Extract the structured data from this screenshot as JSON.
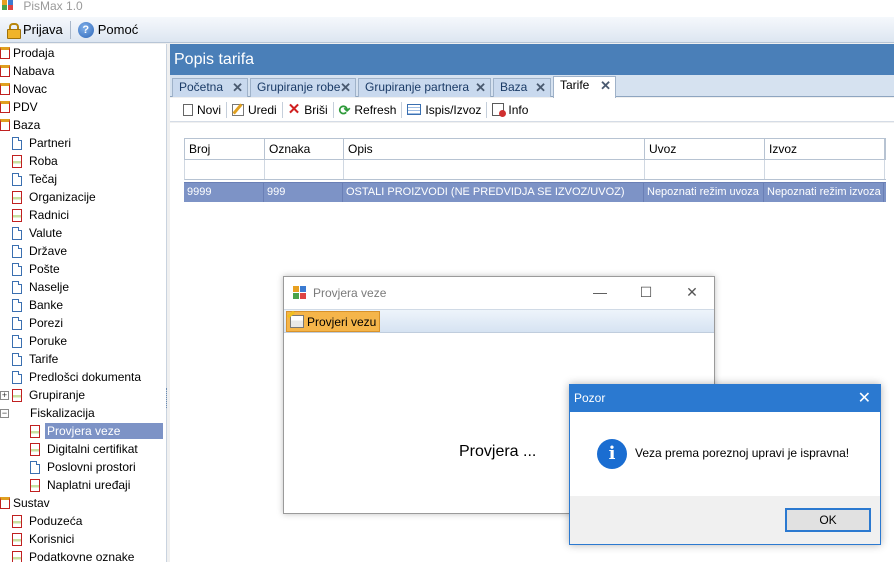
{
  "app": {
    "title": "PisMax 1.0"
  },
  "menu": {
    "login": "Prijava",
    "help": "Pomoć"
  },
  "sidebar": {
    "items": [
      {
        "label": "Prodaja",
        "type": "folder"
      },
      {
        "label": "Nabava",
        "type": "folder"
      },
      {
        "label": "Novac",
        "type": "folder"
      },
      {
        "label": "PDV",
        "type": "folder"
      },
      {
        "label": "Baza",
        "type": "folder"
      },
      {
        "label": "Partneri",
        "type": "doc"
      },
      {
        "label": "Roba",
        "type": "doc-red"
      },
      {
        "label": "Tečaj",
        "type": "doc"
      },
      {
        "label": "Organizacije",
        "type": "doc-red"
      },
      {
        "label": "Radnici",
        "type": "doc-red"
      },
      {
        "label": "Valute",
        "type": "doc"
      },
      {
        "label": "Države",
        "type": "doc"
      },
      {
        "label": "Pošte",
        "type": "doc"
      },
      {
        "label": "Naselje",
        "type": "doc"
      },
      {
        "label": "Banke",
        "type": "doc"
      },
      {
        "label": "Porezi",
        "type": "doc"
      },
      {
        "label": "Poruke",
        "type": "doc"
      },
      {
        "label": "Tarife",
        "type": "doc"
      },
      {
        "label": "Predlošci dokumenta",
        "type": "doc"
      },
      {
        "label": "Grupiranje",
        "type": "doc-red",
        "expander": "+"
      },
      {
        "label": "Fiskalizacija",
        "type": "none",
        "expander": "-"
      },
      {
        "label": "Provjera veze",
        "type": "doc-red",
        "selected": true
      },
      {
        "label": "Digitalni certifikat",
        "type": "doc-red"
      },
      {
        "label": "Poslovni prostori",
        "type": "doc"
      },
      {
        "label": "Naplatni uređaji",
        "type": "doc-red"
      },
      {
        "label": "Sustav",
        "type": "folder"
      },
      {
        "label": "Poduzeća",
        "type": "doc-red"
      },
      {
        "label": "Korisnici",
        "type": "doc-red"
      },
      {
        "label": "Podatkovne oznake",
        "type": "doc-red"
      }
    ]
  },
  "page": {
    "title": "Popis tarifa"
  },
  "tabs": [
    "Početna",
    "Grupiranje robe",
    "Grupiranje partnera",
    "Baza",
    "Tarife"
  ],
  "toolbar": {
    "new": "Novi",
    "edit": "Uredi",
    "delete": "Briši",
    "refresh": "Refresh",
    "print": "Ispis/Izvoz",
    "info": "Info"
  },
  "grid": {
    "columns": [
      "Broj",
      "Oznaka",
      "Opis",
      "Uvoz",
      "Izvoz"
    ],
    "rows": [
      [
        "9999",
        "999",
        "OSTALI PROIZVODI (NE PREDVIDJA SE IZVOZ/UVOZ)",
        "Nepoznati režim uvoza",
        "Nepoznati režim izvoza"
      ]
    ]
  },
  "check_dialog": {
    "title": "Provjera veze",
    "button": "Provjeri vezu",
    "message": "Provjera ..."
  },
  "alert_dialog": {
    "title": "Pozor",
    "message": "Veza prema poreznoj upravi je ispravna!",
    "ok": "OK"
  },
  "colors": {
    "accent": "#4a7fb8",
    "selection": "#7d93c6",
    "dialog_blue": "#2b79d0"
  }
}
